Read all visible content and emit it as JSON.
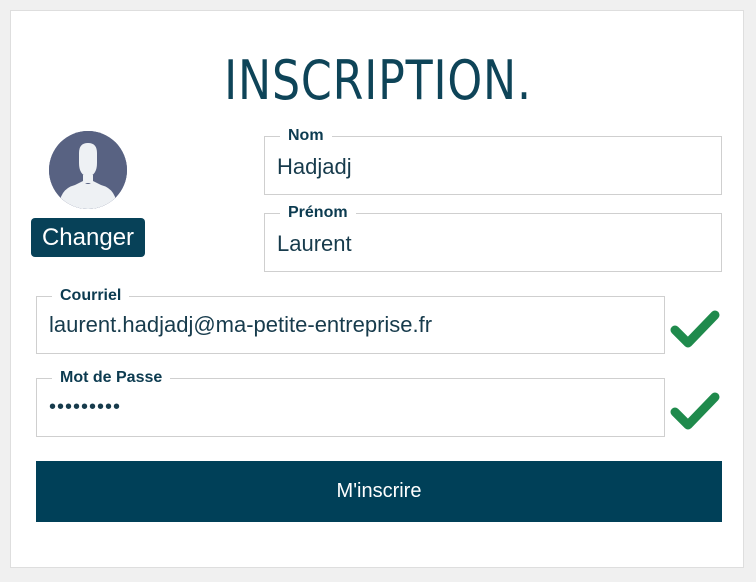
{
  "form": {
    "title": "INSCRIPTION.",
    "avatar": {
      "icon": "user-placeholder-icon",
      "change_label": "Changer"
    },
    "fields": {
      "nom": {
        "label": "Nom",
        "value": "Hadjadj"
      },
      "prenom": {
        "label": "Prénom",
        "value": "Laurent"
      },
      "courriel": {
        "label": "Courriel",
        "value": "laurent.hadjadj@ma-petite-entreprise.fr",
        "valid": true,
        "status_icon": "checkmark-icon"
      },
      "mot_de_passe": {
        "label": "Mot de Passe",
        "value": "•••••••••",
        "valid": true,
        "status_icon": "checkmark-icon"
      }
    },
    "submit_label": "M'inscrire"
  },
  "colors": {
    "primary": "#074158",
    "title": "#0e4458",
    "valid": "#1f8a4c",
    "avatar_bg": "#586282",
    "page_bg": "#f0f0f0"
  }
}
